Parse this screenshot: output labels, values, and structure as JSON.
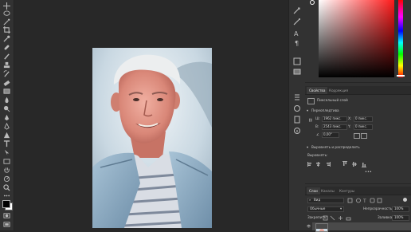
{
  "properties": {
    "tabs": [
      "Свойства",
      "Коррекция"
    ],
    "layer_type": "Пиксельный слой",
    "transform_section": "Переопледтива",
    "w_value": "1962 пикс.",
    "x_value": "0 пикс.",
    "h_value": "2543 пикс.",
    "y_value": "0 пикс.",
    "angle_value": "0,00°",
    "align_section": "Выровнять и распределить",
    "align_label": "Выровнять:"
  },
  "layers": {
    "tabs": [
      "Слои",
      "Каналы",
      "Контуры"
    ],
    "filter_kind": "Вид",
    "blend_mode": "Обычные",
    "opacity_label": "Непрозрачность:",
    "opacity_value": "100%",
    "lock_label": "Закрепить:",
    "fill_label": "Заливка:",
    "fill_value": "100%"
  },
  "colors": {
    "app_bg": "#282828",
    "panel_bg": "#323232",
    "foreground": "#000000",
    "background": "#ffffff"
  }
}
